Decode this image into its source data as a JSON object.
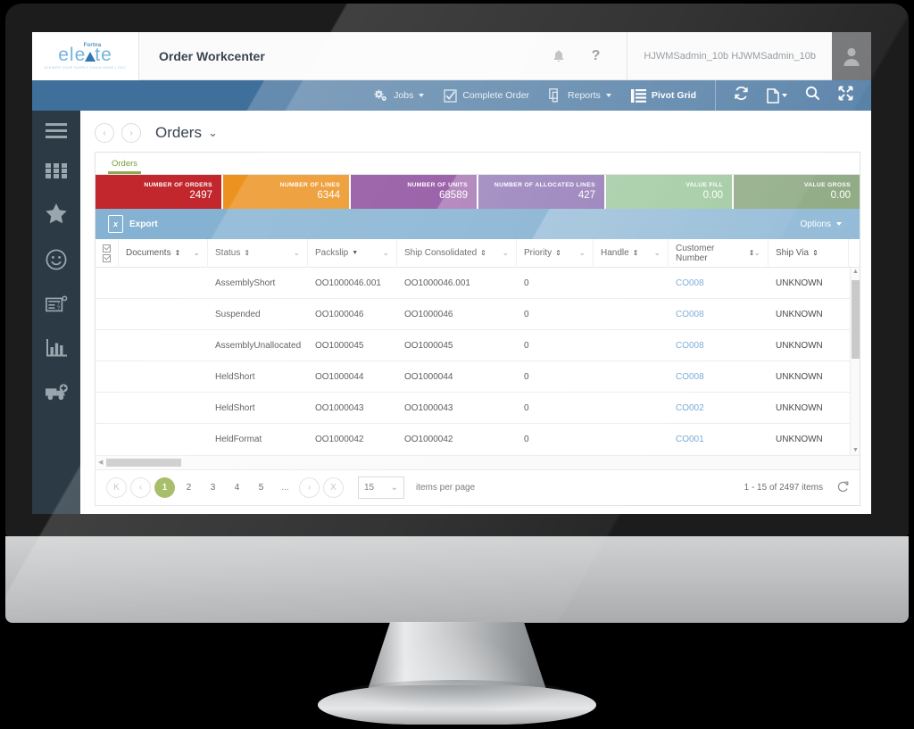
{
  "app": {
    "logo_sup": "Fortna",
    "logo_main_left": "ele",
    "logo_main_right": "te",
    "logo_tagline": "ELEVATE YOUR SUPPLY CHAIN GAME | 2017",
    "title": "Order Workcenter",
    "user": "HJWMSadmin_10b HJWMSadmin_10b",
    "notifications_icon": "bell-icon",
    "help_icon": "question-mark-icon",
    "avatar_icon": "user-avatar-icon"
  },
  "toolbar": {
    "items": [
      {
        "label": "Jobs",
        "icon": "gears-icon",
        "has_caret": true,
        "active": false
      },
      {
        "label": "Complete Order",
        "icon": "check-square-icon",
        "has_caret": false,
        "active": false
      },
      {
        "label": "Reports",
        "icon": "copy-pages-icon",
        "has_caret": true,
        "active": false
      },
      {
        "label": "Pivot Grid",
        "icon": "list-grid-icon",
        "has_caret": false,
        "active": true
      }
    ],
    "right_icons": [
      "refresh-icon",
      "new-document-icon",
      "search-icon",
      "fullscreen-icon"
    ]
  },
  "sidebar": {
    "items": [
      {
        "name": "menu-icon"
      },
      {
        "name": "apps-grid-icon"
      },
      {
        "name": "star-icon"
      },
      {
        "name": "smiley-icon"
      },
      {
        "name": "form-help-icon"
      },
      {
        "name": "bar-chart-icon"
      },
      {
        "name": "ambulance-icon"
      }
    ]
  },
  "page": {
    "back_icon": "chevron-left-icon",
    "forward_icon": "chevron-right-icon",
    "title": "Orders",
    "title_caret": "⌄",
    "tab": "Orders"
  },
  "kpis": [
    {
      "label": "NUMBER OF ORDERS",
      "value": "2497",
      "color": "#c1272d"
    },
    {
      "label": "NUMBER OF LINES",
      "value": "6344",
      "color": "#ec9220"
    },
    {
      "label": "NUMBER OF UNITS",
      "value": "68589",
      "color": "#8e4e9e"
    },
    {
      "label": "NUMBER OF ALLOCATED LINES",
      "value": "427",
      "color": "#7a5ba6"
    },
    {
      "label": "VALUE FILL",
      "value": "0.00",
      "color": "#8fc08f"
    },
    {
      "label": "VALUE GROSS",
      "value": "0.00",
      "color": "#7f9e72"
    }
  ],
  "grid_toolbar": {
    "export_label": "Export",
    "export_icon": "excel-export-icon",
    "options_label": "Options",
    "options_icon": "caret-down-icon"
  },
  "grid": {
    "select_all_icon": "select-all-checkbox-icon",
    "columns": [
      {
        "label": "Documents",
        "sort": "both",
        "filter": true
      },
      {
        "label": "Status",
        "sort": "both",
        "filter": true
      },
      {
        "label": "Packslip",
        "sort": "down",
        "filter": true
      },
      {
        "label": "Ship Consolidated",
        "sort": "both",
        "filter": true
      },
      {
        "label": "Priority",
        "sort": "both",
        "filter": true
      },
      {
        "label": "Handle",
        "sort": "both",
        "filter": true
      },
      {
        "label": "Customer Number",
        "sort": "both",
        "filter": true
      },
      {
        "label": "Ship Via",
        "sort": "both",
        "filter": false
      }
    ],
    "rows": [
      {
        "documents": "",
        "status": "AssemblyShort",
        "packslip": "OO1000046.001",
        "ship_consolidated": "OO1000046.001",
        "priority": "0",
        "handle": "",
        "customer_number": "CO008",
        "ship_via": "UNKNOWN"
      },
      {
        "documents": "",
        "status": "Suspended",
        "packslip": "OO1000046",
        "ship_consolidated": "OO1000046",
        "priority": "0",
        "handle": "",
        "customer_number": "CO008",
        "ship_via": "UNKNOWN"
      },
      {
        "documents": "",
        "status": "AssemblyUnallocated",
        "packslip": "OO1000045",
        "ship_consolidated": "OO1000045",
        "priority": "0",
        "handle": "",
        "customer_number": "CO008",
        "ship_via": "UNKNOWN"
      },
      {
        "documents": "",
        "status": "HeldShort",
        "packslip": "OO1000044",
        "ship_consolidated": "OO1000044",
        "priority": "0",
        "handle": "",
        "customer_number": "CO008",
        "ship_via": "UNKNOWN"
      },
      {
        "documents": "",
        "status": "HeldShort",
        "packslip": "OO1000043",
        "ship_consolidated": "OO1000043",
        "priority": "0",
        "handle": "",
        "customer_number": "CO002",
        "ship_via": "UNKNOWN"
      },
      {
        "documents": "",
        "status": "HeldFormat",
        "packslip": "OO1000042",
        "ship_consolidated": "OO1000042",
        "priority": "0",
        "handle": "",
        "customer_number": "CO001",
        "ship_via": "UNKNOWN"
      }
    ]
  },
  "pager": {
    "first": "K",
    "prev": "‹",
    "pages": [
      "1",
      "2",
      "3",
      "4",
      "5"
    ],
    "ellipsis": "...",
    "next": "›",
    "last": "X",
    "active_page": "1",
    "items_per_page_value": "15",
    "items_per_page_caret": "⌄",
    "items_per_page_label": "items per page",
    "summary": "1 - 15 of 2497 items",
    "refresh_icon": "refresh-page-icon"
  },
  "colors": {
    "brand_blue": "#3f6f9b",
    "grid_header_blue": "#85b2d2",
    "accent_green": "#99b352",
    "sidebar_dark": "#2b3a45"
  }
}
